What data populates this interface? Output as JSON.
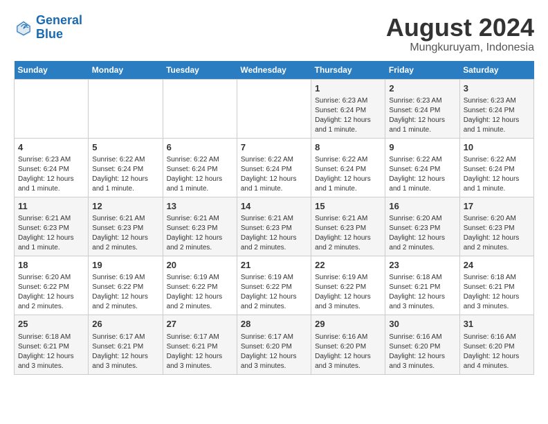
{
  "logo": {
    "line1": "General",
    "line2": "Blue"
  },
  "title": "August 2024",
  "subtitle": "Mungkuruyam, Indonesia",
  "days_of_week": [
    "Sunday",
    "Monday",
    "Tuesday",
    "Wednesday",
    "Thursday",
    "Friday",
    "Saturday"
  ],
  "weeks": [
    [
      {
        "day": "",
        "info": ""
      },
      {
        "day": "",
        "info": ""
      },
      {
        "day": "",
        "info": ""
      },
      {
        "day": "",
        "info": ""
      },
      {
        "day": "1",
        "info": "Sunrise: 6:23 AM\nSunset: 6:24 PM\nDaylight: 12 hours and 1 minute."
      },
      {
        "day": "2",
        "info": "Sunrise: 6:23 AM\nSunset: 6:24 PM\nDaylight: 12 hours and 1 minute."
      },
      {
        "day": "3",
        "info": "Sunrise: 6:23 AM\nSunset: 6:24 PM\nDaylight: 12 hours and 1 minute."
      }
    ],
    [
      {
        "day": "4",
        "info": "Sunrise: 6:23 AM\nSunset: 6:24 PM\nDaylight: 12 hours and 1 minute."
      },
      {
        "day": "5",
        "info": "Sunrise: 6:22 AM\nSunset: 6:24 PM\nDaylight: 12 hours and 1 minute."
      },
      {
        "day": "6",
        "info": "Sunrise: 6:22 AM\nSunset: 6:24 PM\nDaylight: 12 hours and 1 minute."
      },
      {
        "day": "7",
        "info": "Sunrise: 6:22 AM\nSunset: 6:24 PM\nDaylight: 12 hours and 1 minute."
      },
      {
        "day": "8",
        "info": "Sunrise: 6:22 AM\nSunset: 6:24 PM\nDaylight: 12 hours and 1 minute."
      },
      {
        "day": "9",
        "info": "Sunrise: 6:22 AM\nSunset: 6:24 PM\nDaylight: 12 hours and 1 minute."
      },
      {
        "day": "10",
        "info": "Sunrise: 6:22 AM\nSunset: 6:24 PM\nDaylight: 12 hours and 1 minute."
      }
    ],
    [
      {
        "day": "11",
        "info": "Sunrise: 6:21 AM\nSunset: 6:23 PM\nDaylight: 12 hours and 1 minute."
      },
      {
        "day": "12",
        "info": "Sunrise: 6:21 AM\nSunset: 6:23 PM\nDaylight: 12 hours and 2 minutes."
      },
      {
        "day": "13",
        "info": "Sunrise: 6:21 AM\nSunset: 6:23 PM\nDaylight: 12 hours and 2 minutes."
      },
      {
        "day": "14",
        "info": "Sunrise: 6:21 AM\nSunset: 6:23 PM\nDaylight: 12 hours and 2 minutes."
      },
      {
        "day": "15",
        "info": "Sunrise: 6:21 AM\nSunset: 6:23 PM\nDaylight: 12 hours and 2 minutes."
      },
      {
        "day": "16",
        "info": "Sunrise: 6:20 AM\nSunset: 6:23 PM\nDaylight: 12 hours and 2 minutes."
      },
      {
        "day": "17",
        "info": "Sunrise: 6:20 AM\nSunset: 6:23 PM\nDaylight: 12 hours and 2 minutes."
      }
    ],
    [
      {
        "day": "18",
        "info": "Sunrise: 6:20 AM\nSunset: 6:22 PM\nDaylight: 12 hours and 2 minutes."
      },
      {
        "day": "19",
        "info": "Sunrise: 6:19 AM\nSunset: 6:22 PM\nDaylight: 12 hours and 2 minutes."
      },
      {
        "day": "20",
        "info": "Sunrise: 6:19 AM\nSunset: 6:22 PM\nDaylight: 12 hours and 2 minutes."
      },
      {
        "day": "21",
        "info": "Sunrise: 6:19 AM\nSunset: 6:22 PM\nDaylight: 12 hours and 2 minutes."
      },
      {
        "day": "22",
        "info": "Sunrise: 6:19 AM\nSunset: 6:22 PM\nDaylight: 12 hours and 3 minutes."
      },
      {
        "day": "23",
        "info": "Sunrise: 6:18 AM\nSunset: 6:21 PM\nDaylight: 12 hours and 3 minutes."
      },
      {
        "day": "24",
        "info": "Sunrise: 6:18 AM\nSunset: 6:21 PM\nDaylight: 12 hours and 3 minutes."
      }
    ],
    [
      {
        "day": "25",
        "info": "Sunrise: 6:18 AM\nSunset: 6:21 PM\nDaylight: 12 hours and 3 minutes."
      },
      {
        "day": "26",
        "info": "Sunrise: 6:17 AM\nSunset: 6:21 PM\nDaylight: 12 hours and 3 minutes."
      },
      {
        "day": "27",
        "info": "Sunrise: 6:17 AM\nSunset: 6:21 PM\nDaylight: 12 hours and 3 minutes."
      },
      {
        "day": "28",
        "info": "Sunrise: 6:17 AM\nSunset: 6:20 PM\nDaylight: 12 hours and 3 minutes."
      },
      {
        "day": "29",
        "info": "Sunrise: 6:16 AM\nSunset: 6:20 PM\nDaylight: 12 hours and 3 minutes."
      },
      {
        "day": "30",
        "info": "Sunrise: 6:16 AM\nSunset: 6:20 PM\nDaylight: 12 hours and 3 minutes."
      },
      {
        "day": "31",
        "info": "Sunrise: 6:16 AM\nSunset: 6:20 PM\nDaylight: 12 hours and 4 minutes."
      }
    ]
  ]
}
